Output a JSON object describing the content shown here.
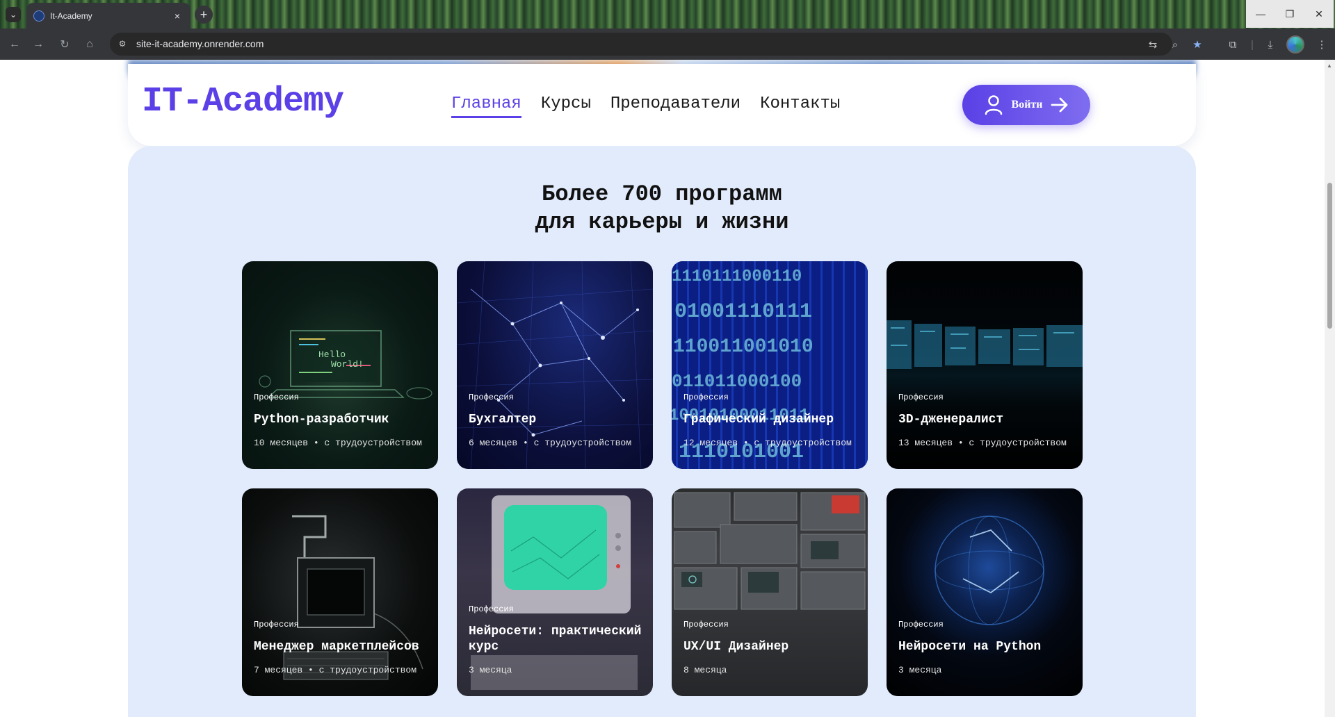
{
  "browser": {
    "tab_title": "It-Academy",
    "url": "site-it-academy.onrender.com"
  },
  "header": {
    "logo": "IT-Academy",
    "nav": [
      {
        "label": "Главная",
        "active": true
      },
      {
        "label": "Курсы",
        "active": false
      },
      {
        "label": "Преподаватели",
        "active": false
      },
      {
        "label": "Контакты",
        "active": false
      }
    ],
    "login_label": "Войти"
  },
  "programs": {
    "headline_line1": "Более 700 программ",
    "headline_line2": "для карьеры и жизни",
    "cards": [
      {
        "kind": "Профессия",
        "title": "Python-разработчик",
        "meta": "10 месяцев • с трудоустройством"
      },
      {
        "kind": "Профессия",
        "title": "Бухгалтер",
        "meta": "6 месяцев • с трудоустройством"
      },
      {
        "kind": "Профессия",
        "title": "Графический дизайнер",
        "meta": "12 месяцев • с трудоустройством"
      },
      {
        "kind": "Профессия",
        "title": "3D-дженералист",
        "meta": "13 месяцев • с трудоустройством"
      },
      {
        "kind": "Профессия",
        "title": "Менеджер маркетплейсов",
        "meta": "7 месяцев • с трудоустройством"
      },
      {
        "kind": "Профессия",
        "title": "Нейросети: практический курс",
        "meta": "3 месяца"
      },
      {
        "kind": "Профессия",
        "title": "UX/UI Дизайнер",
        "meta": "8 месяца"
      },
      {
        "kind": "Профессия",
        "title": "Нейросети на Python",
        "meta": "3 месяца"
      }
    ],
    "art": {
      "python_code_1": "Hello",
      "python_code_2": "World!",
      "binary_rows": [
        "1110111000110",
        "01001110111",
        "110011001010",
        "011011000100",
        "10010100011011",
        "1110101001"
      ]
    }
  },
  "colors": {
    "accent": "#5a40e6",
    "section_bg": "#e2ebfb",
    "chrome": "#35363a"
  }
}
